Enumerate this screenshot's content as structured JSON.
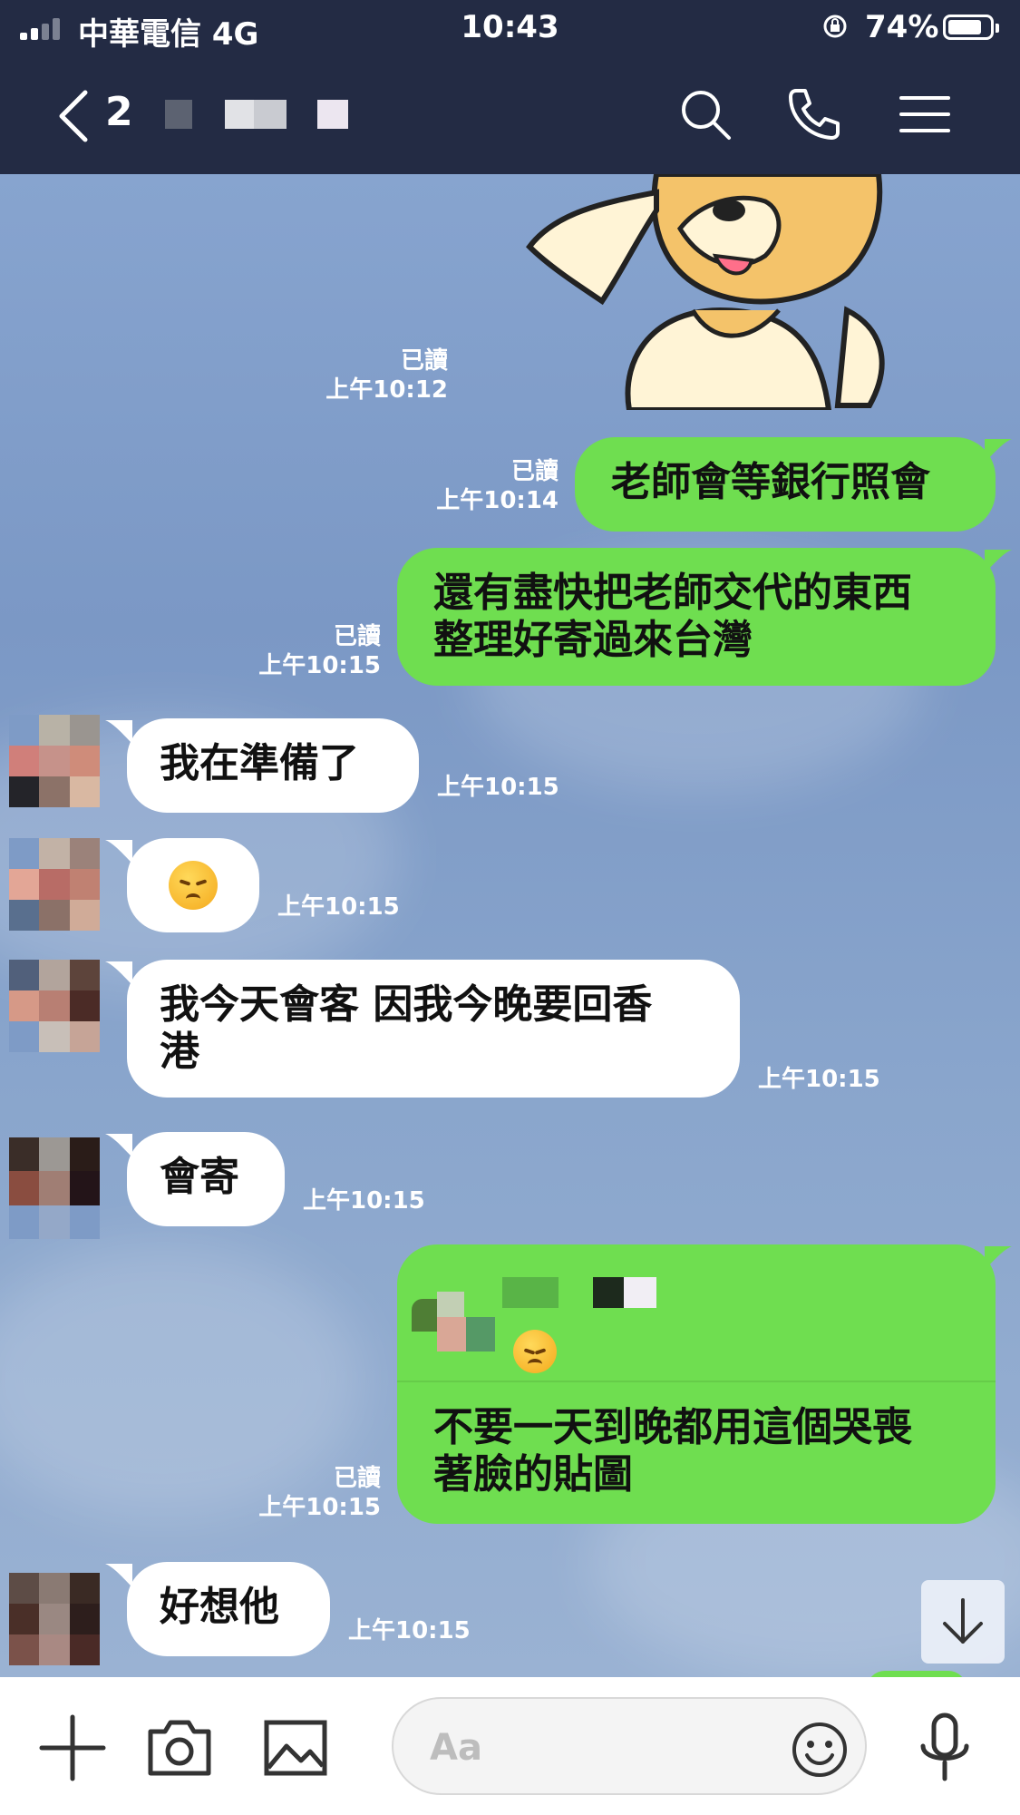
{
  "status_bar": {
    "carrier": "中華電信 4G",
    "time": "10:43",
    "battery": "74%"
  },
  "header": {
    "member_count": "2",
    "icons": [
      "back-chevron-icon",
      "search-icon",
      "phone-icon",
      "menu-icon"
    ]
  },
  "messages": [
    {
      "id": "m0",
      "side": "out",
      "type": "sticker",
      "read": "已讀",
      "time": "上午10:12"
    },
    {
      "id": "m1",
      "side": "out",
      "text": "老師會等銀行照會",
      "read": "已讀",
      "time": "上午10:14"
    },
    {
      "id": "m2",
      "side": "out",
      "lines": [
        "還有盡快把老師交代的東西",
        "整理好寄過來台灣"
      ],
      "read": "已讀",
      "time": "上午10:15"
    },
    {
      "id": "m3",
      "side": "in",
      "text": "我在準備了",
      "time": "上午10:15"
    },
    {
      "id": "m4",
      "side": "in",
      "type": "emoji",
      "emoji": "disappointed-face",
      "time": "上午10:15"
    },
    {
      "id": "m5",
      "side": "in",
      "lines": [
        "我今天會客 因我今晚要回香",
        "港"
      ],
      "time": "上午10:15"
    },
    {
      "id": "m6",
      "side": "in",
      "text": "會寄",
      "time": "上午10:15"
    },
    {
      "id": "m7",
      "side": "out",
      "type": "reply",
      "quoted_emoji": "disappointed-face",
      "lines": [
        "不要一天到晚都用這個哭喪",
        "著臉的貼圖"
      ],
      "read": "已讀",
      "time": "上午10:15"
    },
    {
      "id": "m8",
      "side": "in",
      "text": "好想他",
      "time": "上午10:15"
    }
  ],
  "composer": {
    "placeholder": "Aa",
    "icons": [
      "plus-icon",
      "camera-icon",
      "image-icon",
      "emoji-icon",
      "microphone-icon"
    ]
  },
  "colors": {
    "nav_bg": "#232b44",
    "outgoing_bubble": "#6fde50",
    "incoming_bubble": "#ffffff",
    "chat_bg": "#7f9cc8"
  }
}
